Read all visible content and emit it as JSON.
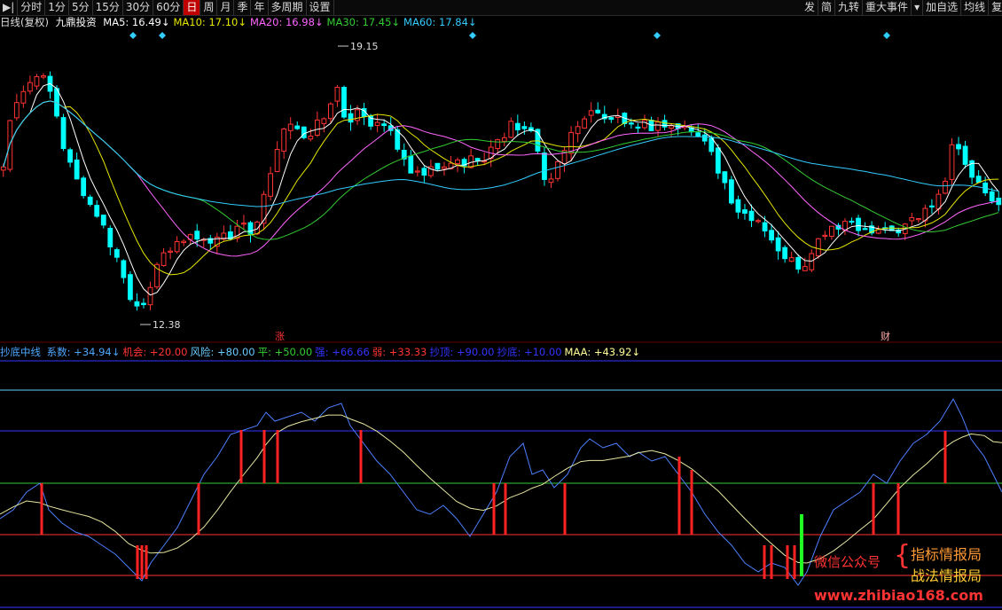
{
  "toolbar": {
    "left": [
      {
        "label": "分时",
        "active": false
      },
      {
        "label": "1分",
        "active": false
      },
      {
        "label": "5分",
        "active": false
      },
      {
        "label": "15分",
        "active": false
      },
      {
        "label": "30分",
        "active": false
      },
      {
        "label": "60分",
        "active": false
      },
      {
        "label": "日",
        "active": true
      },
      {
        "label": "周",
        "active": false
      },
      {
        "label": "月",
        "active": false
      },
      {
        "label": "季",
        "active": false
      },
      {
        "label": "年",
        "active": false
      },
      {
        "label": "多周期",
        "active": false
      },
      {
        "label": "设置",
        "active": false
      }
    ],
    "right": [
      "发",
      "简",
      "九转",
      "重大事件",
      "▾",
      "加自选",
      "均线",
      "复"
    ]
  },
  "header": {
    "period": "日线(复权)",
    "stock": "九鼎投资",
    "ma": [
      {
        "label": "MA5: 16.49↓",
        "color": "#ffffff"
      },
      {
        "label": "MA10: 17.10↓",
        "color": "#e6e600"
      },
      {
        "label": "MA20: 16.98↓",
        "color": "#ff66ff"
      },
      {
        "label": "MA30: 17.45↓",
        "color": "#33cc33"
      },
      {
        "label": "MA60: 17.84↓",
        "color": "#33ccff"
      }
    ]
  },
  "price": {
    "high_label": "19.15",
    "low_label": "12.38",
    "marks": [
      "涨",
      "财"
    ]
  },
  "indicator": {
    "name": "抄底中线",
    "items": [
      {
        "label": "系数: +34.94↓",
        "color": "#4da6ff"
      },
      {
        "label": "机会: +20.00",
        "color": "#ff3333"
      },
      {
        "label": "风险: +80.00",
        "color": "#66ccff"
      },
      {
        "label": "平: +50.00",
        "color": "#33cc33"
      },
      {
        "label": "强: +66.66",
        "color": "#3333ff"
      },
      {
        "label": "弱: +33.33",
        "color": "#ff3333"
      },
      {
        "label": "抄顶: +90.00",
        "color": "#3333ff"
      },
      {
        "label": "抄底: +10.00",
        "color": "#3333ff"
      },
      {
        "label": "MAA: +43.92↓",
        "color": "#ffff99"
      }
    ]
  },
  "watermark": {
    "prefix": "微信公众号",
    "line1": "指标情报局",
    "line2": "战法情报局",
    "url": "www.zhibiao168.com"
  },
  "colors": {
    "up": "#ff3333",
    "down": "#00ffff"
  }
}
